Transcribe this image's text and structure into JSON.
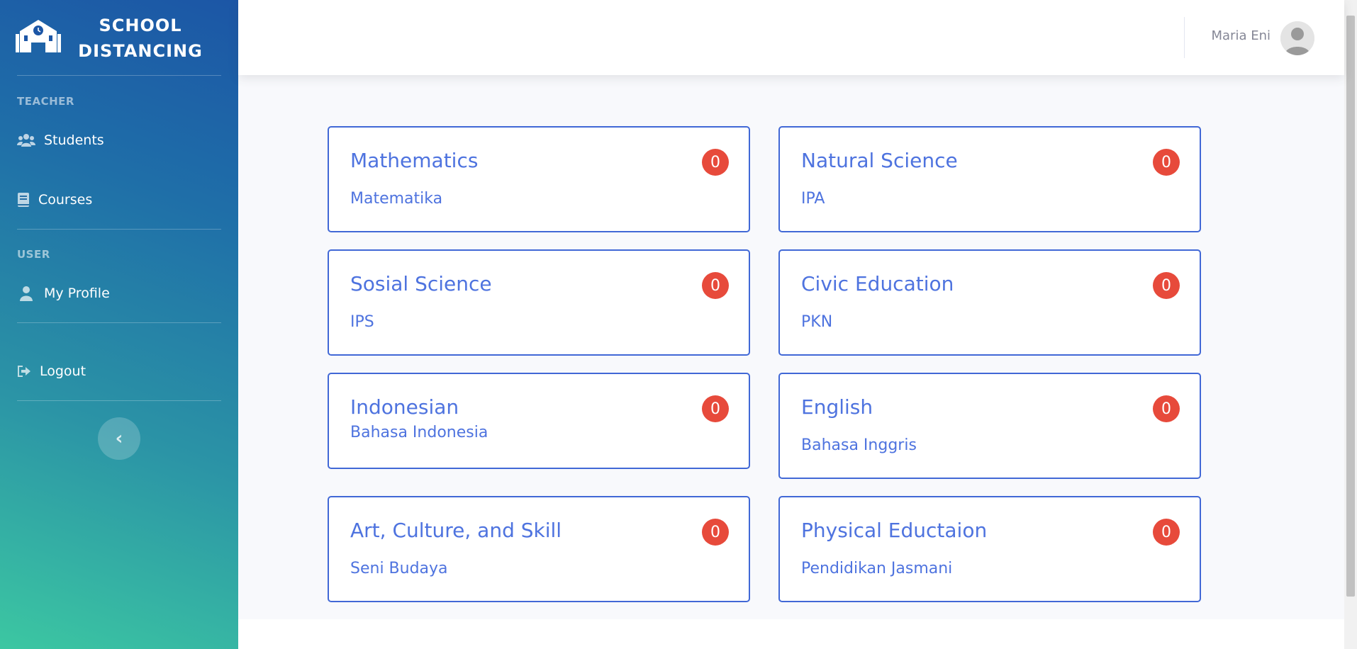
{
  "brand": {
    "line1": "SCHOOL",
    "line2": "DISTANCING",
    "logo_icon": "school-icon"
  },
  "sidebar": {
    "sections": [
      {
        "heading": "TEACHER"
      },
      {
        "heading": "USER"
      }
    ],
    "items": [
      {
        "label": "Students",
        "icon": "users-icon"
      },
      {
        "label": "Courses",
        "icon": "book-icon"
      },
      {
        "label": "My Profile",
        "icon": "user-icon"
      },
      {
        "label": "Logout",
        "icon": "sign-out-icon"
      }
    ],
    "collapse_icon": "chevron-left-icon"
  },
  "topbar": {
    "user_name": "Maria Eni"
  },
  "courses": [
    {
      "title": "Mathematics",
      "subtitle": "Matematika",
      "count": "0"
    },
    {
      "title": "Natural Science",
      "subtitle": "IPA",
      "count": "0"
    },
    {
      "title": "Sosial Science",
      "subtitle": "IPS",
      "count": "0"
    },
    {
      "title": "Civic Education",
      "subtitle": "PKN",
      "count": "0"
    },
    {
      "title": "Indonesian",
      "subtitle": "Bahasa Indonesia",
      "count": "0"
    },
    {
      "title": "English",
      "subtitle": "Bahasa Inggris",
      "count": "0"
    },
    {
      "title": "Art, Culture, and Skill",
      "subtitle": "Seni Budaya",
      "count": "0"
    },
    {
      "title": "Physical Eductaion",
      "subtitle": "Pendidikan Jasmani",
      "count": "0"
    }
  ],
  "colors": {
    "primary": "#4e73df",
    "badge": "#e74a3b",
    "sidebar_top": "#1c56a6",
    "sidebar_bottom": "#3cc7a2"
  }
}
